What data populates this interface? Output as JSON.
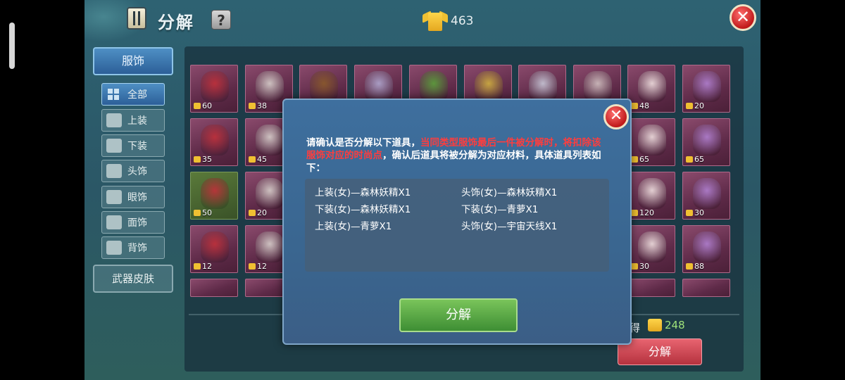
{
  "header": {
    "title": "分解",
    "help_label": "?",
    "currency_value": "463",
    "close_label": "✕"
  },
  "sidebar": {
    "main_tab": "服饰",
    "sub_tabs": [
      {
        "label": "全部"
      },
      {
        "label": "上装"
      },
      {
        "label": "下装"
      },
      {
        "label": "头饰"
      },
      {
        "label": "眼饰"
      },
      {
        "label": "面饰"
      },
      {
        "label": "背饰"
      }
    ],
    "weapon_tab": "武器皮肤"
  },
  "grid": {
    "rows": [
      [
        "60",
        "38",
        "",
        "",
        "",
        "",
        "",
        "",
        "48",
        "20"
      ],
      [
        "35",
        "45",
        "",
        "",
        "",
        "",
        "",
        "",
        "65",
        "65"
      ],
      [
        "50",
        "20",
        "",
        "",
        "",
        "",
        "",
        "",
        "120",
        "30"
      ],
      [
        "12",
        "12",
        "",
        "",
        "",
        "",
        "",
        "",
        "30",
        "88"
      ]
    ]
  },
  "footer": {
    "total_label": "得",
    "total_value": "248",
    "decompose_label": "分解"
  },
  "modal": {
    "text_part1": "请确认是否分解以下道具，",
    "text_warning": "当同类型服饰最后一件被分解时，将扣除该服饰对应的时尚点",
    "text_part2": "，确认后道具将被分解为对应材料，具体道具列表如下：",
    "items": [
      "上装(女)—森林妖精X1",
      "头饰(女)—森林妖精X1",
      "下装(女)—森林妖精X1",
      "下装(女)—青萝X1",
      "上装(女)—青萝X1",
      "头饰(女)—宇宙天线X1"
    ],
    "confirm_label": "分解",
    "close_label": "✕"
  },
  "colors": {
    "warning": "#ff3d3d",
    "confirm": "#4fa63e",
    "decompose": "#d24a56",
    "accent": "#2c5f98"
  }
}
